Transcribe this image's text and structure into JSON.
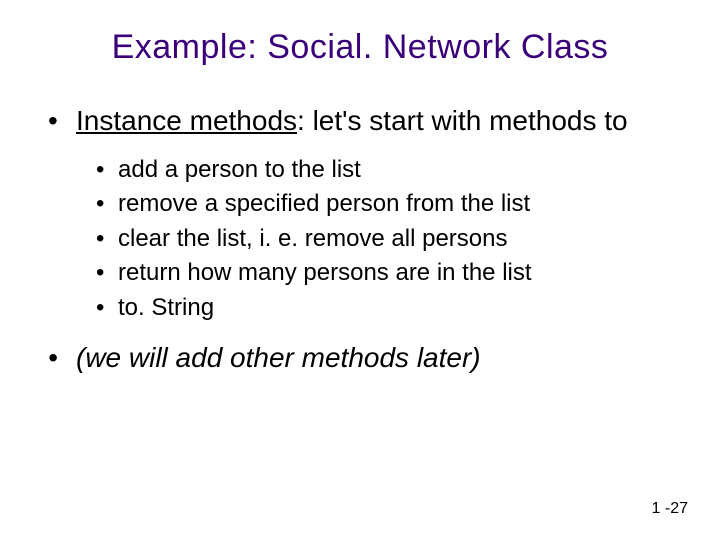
{
  "title": "Example: Social. Network Class",
  "bullets": {
    "item1_label": "Instance methods",
    "item1_rest": ": let's start with methods to",
    "sub": {
      "a": "add a person to the list",
      "b": "remove a specified person from the list",
      "c": "clear the list, i. e. remove all persons",
      "d": "return how many persons are in the list",
      "e": "to. String"
    },
    "item2": "(we will add other methods later)"
  },
  "slide_number": "1 -27"
}
